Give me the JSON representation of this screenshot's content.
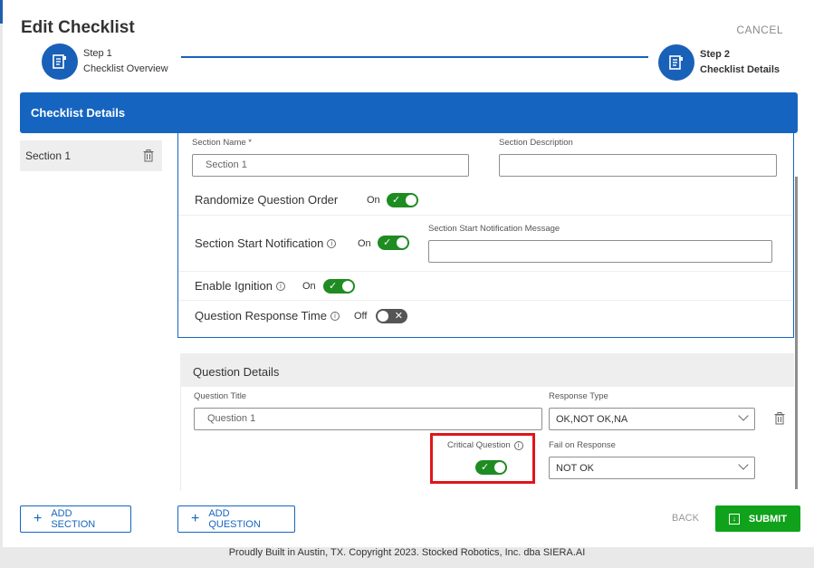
{
  "header": {
    "title": "Edit Checklist",
    "cancel_label": "CANCEL"
  },
  "stepper": {
    "step1": {
      "step": "Step 1",
      "name": "Checklist Overview"
    },
    "step2": {
      "step": "Step 2",
      "name": "Checklist Details"
    }
  },
  "banner": {
    "title": "Checklist Details"
  },
  "sections": [
    {
      "label": "Section 1"
    }
  ],
  "section_form": {
    "name_label": "Section Name *",
    "name_value": "Section 1",
    "description_label": "Section Description",
    "description_value": "",
    "randomize": {
      "label": "Randomize Question Order",
      "state": "On"
    },
    "start_notification": {
      "label": "Section Start Notification",
      "state": "On",
      "message_label": "Section Start Notification Message",
      "message_value": ""
    },
    "ignition": {
      "label": "Enable Ignition",
      "state": "On"
    },
    "response_time": {
      "label": "Question Response Time",
      "state": "Off"
    },
    "info_glyph": "i"
  },
  "question": {
    "header": "Question Details",
    "title_label": "Question Title",
    "title_value": "Question 1",
    "response_type_label": "Response Type",
    "response_type_value": "OK,NOT OK,NA",
    "critical_label": "Critical Question",
    "critical_on": true,
    "fail_label": "Fail on Response",
    "fail_value": "NOT OK"
  },
  "actions": {
    "add_section": "ADD SECTION",
    "add_question": "ADD QUESTION",
    "back": "BACK",
    "submit": "SUBMIT"
  },
  "footer": {
    "text": "Proudly Built in Austin, TX. Copyright 2023. Stocked Robotics, Inc. dba SIERA.AI"
  },
  "colors": {
    "primary": "#1565c0",
    "toggle_on": "#1e8c21",
    "submit": "#10a21b",
    "highlight": "#e0151a"
  },
  "icons": {
    "step": "checklist-doc-icon",
    "trash": "trash-icon",
    "info": "info-icon",
    "check": "check-icon",
    "x": "close-icon",
    "plus": "plus-icon",
    "submit": "submit-icon"
  }
}
